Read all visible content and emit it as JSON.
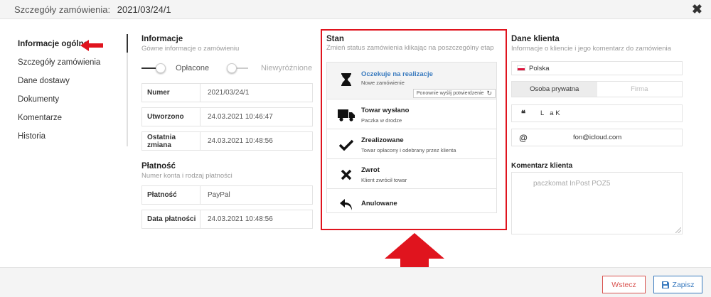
{
  "header": {
    "title_label": "Szczegóły zamówienia:",
    "order_number": "2021/03/24/1"
  },
  "nav": {
    "items": [
      {
        "label": "Informacje ogólne"
      },
      {
        "label": "Szczegóły zamówienia"
      },
      {
        "label": "Dane dostawy"
      },
      {
        "label": "Dokumenty"
      },
      {
        "label": "Komentarze"
      },
      {
        "label": "Historia"
      }
    ]
  },
  "info": {
    "title": "Informacje",
    "subtitle": "Gówne informacje o zamówieniu",
    "toggle_paid": "Opłacone",
    "toggle_unmarked": "Niewyróżnione",
    "rows": [
      {
        "label": "Numer",
        "value": "2021/03/24/1"
      },
      {
        "label": "Utworzono",
        "value": "24.03.2021 10:46:47"
      },
      {
        "label": "Ostatnia zmiana",
        "value": "24.03.2021 10:48:56"
      }
    ]
  },
  "payment": {
    "title": "Płatność",
    "subtitle": "Numer konta i rodzaj płatności",
    "rows": [
      {
        "label": "Płatność",
        "value": "PayPal"
      },
      {
        "label": "Data płatności",
        "value": "24.03.2021 10:48:56"
      }
    ]
  },
  "status": {
    "title": "Stan",
    "subtitle": "Zmień status zamówienia klikając na poszczególny etap",
    "resend_label": "Ponownie wyślij potwierdzenie",
    "items": [
      {
        "name": "Oczekuje na realizacje",
        "desc": "Nowe zamówienie"
      },
      {
        "name": "Towar wysłano",
        "desc": "Paczka w drodze"
      },
      {
        "name": "Zrealizowane",
        "desc": "Towar opłacony i odebrany przez klienta"
      },
      {
        "name": "Zwrot",
        "desc": "Klient zwrócił towar"
      },
      {
        "name": "Anulowane",
        "desc": ""
      }
    ]
  },
  "client": {
    "title": "Dane klienta",
    "subtitle": "Informacje o kliencie i jego komentarz do zamówienia",
    "country": "Polska",
    "type_private": "Osoba prywatna",
    "type_company": "Firma",
    "name_prefix": "L",
    "name_suffix": "a K",
    "email": "fon@icloud.com",
    "comment_title": "Komentarz klienta",
    "comment": "paczkomat InPost POZ5"
  },
  "footer": {
    "back_label": "Wstecz",
    "save_label": "Zapisz"
  },
  "colors": {
    "accent_red": "#e0141e",
    "accent_blue": "#3a7bbf"
  }
}
